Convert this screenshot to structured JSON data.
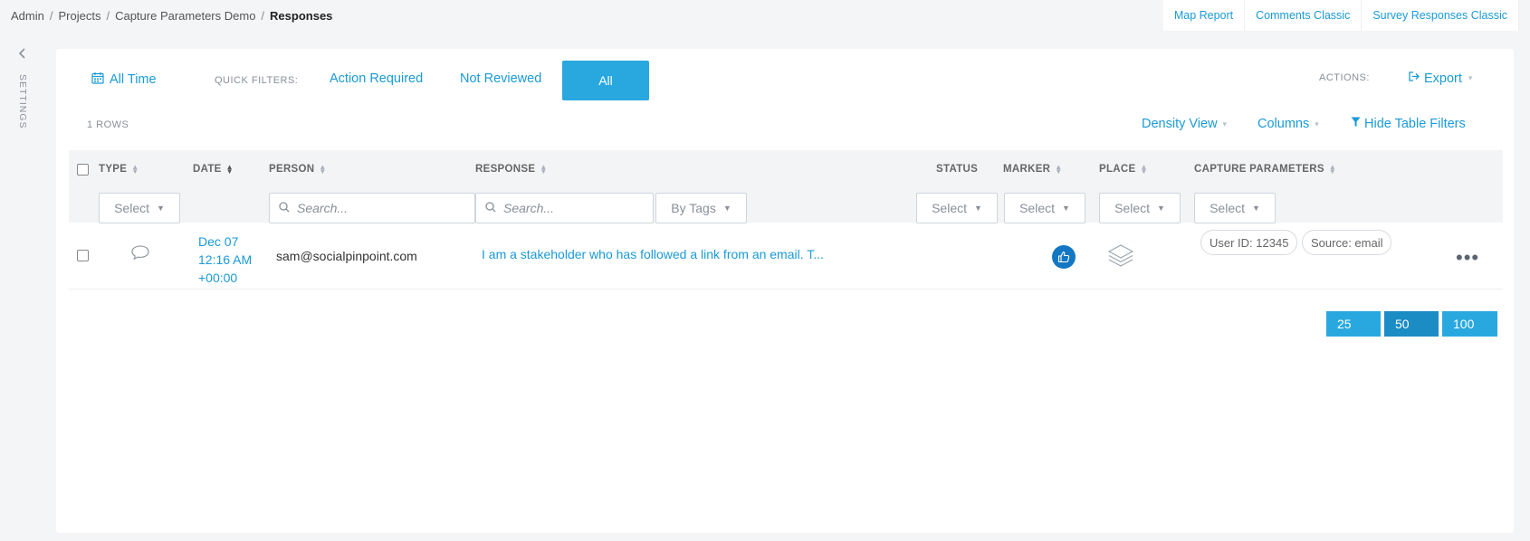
{
  "breadcrumb": {
    "items": [
      "Admin",
      "Projects",
      "Capture Parameters Demo"
    ],
    "separator": "/",
    "current": "Responses"
  },
  "top_links": [
    "Map Report",
    "Comments Classic",
    "Survey Responses Classic"
  ],
  "sidebar": {
    "label": "SETTINGS",
    "toggle_icon": "chevron-left-icon"
  },
  "filters": {
    "date_range": "All Time",
    "quick_filters_label": "QUICK FILTERS:",
    "quick_filters": [
      "Action Required",
      "Not Reviewed",
      "All"
    ],
    "active_quick_filter": "All",
    "actions_label": "ACTIONS:",
    "export_label": "Export"
  },
  "table_meta": {
    "row_count": "1 ROWS",
    "density_view": "Density View",
    "columns": "Columns",
    "hide_filters": "Hide Table Filters"
  },
  "columns": {
    "type": "TYPE",
    "date": "DATE",
    "person": "PERSON",
    "response": "RESPONSE",
    "status": "STATUS",
    "marker": "MARKER",
    "place": "PLACE",
    "capture_parameters": "CAPTURE PARAMETERS"
  },
  "column_filters": {
    "type": "Select",
    "person_placeholder": "Search...",
    "response_placeholder": "Search...",
    "tags": "By Tags",
    "status": "Select",
    "marker": "Select",
    "place": "Select",
    "capture_parameters": "Select"
  },
  "rows": [
    {
      "type_icon": "comment-icon",
      "date_line1": "Dec 07",
      "date_line2": "12:16 AM",
      "date_line3": "+00:00",
      "person": "sam@socialpinpoint.com",
      "response": "I am a stakeholder who has followed a link from an email. T...",
      "status": "",
      "marker_icon": "thumbs-up-icon",
      "place_icon": "layers-icon",
      "capture_parameters": [
        "User ID: 12345",
        "Source: email"
      ],
      "actions_icon": "more-icon"
    }
  ],
  "pagination": {
    "page_sizes": [
      "25",
      "50",
      "100"
    ],
    "active_page_size": "50"
  },
  "colors": {
    "accent": "#29a8df",
    "link": "#1a9ad6",
    "pager_active": "#1b8cc4",
    "marker": "#1477c4"
  }
}
